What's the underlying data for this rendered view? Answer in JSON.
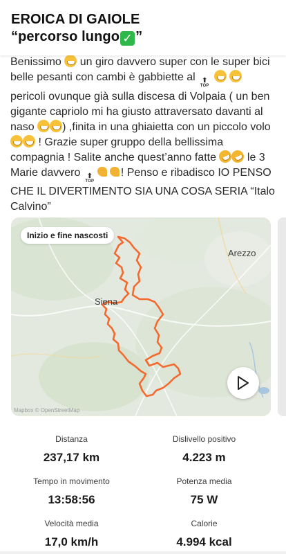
{
  "activity": {
    "title_line1": "EROICA DI GAIOLE",
    "title_line2": "“percorso lungo",
    "title_emoji": "✓",
    "title_end": "”"
  },
  "description": {
    "p1": "Benissimo",
    "p2": "un giro davvero super con le super bici belle pesanti con cambi è gabbiette al",
    "p3": "pericoli ovunque già sulla discesa di Volpaia ( un ben gigante capriolo mi ha giusto attraversato davanti al naso",
    "p4": ") ,finita in una ghiaietta con un piccolo volo",
    "p5": "! Grazie super gruppo della bellissima compagnia ! Salite anche quest’anno fatte",
    "p6": "le 3 Marie davvero",
    "p7": "! Penso e ribadisco IO PENSO CHE IL DIVERTIMENTO SIA UNA COSA SERIA “Italo Calvino”",
    "top_label": "TOP",
    "top_arrow": "⬆"
  },
  "map": {
    "badge": "Inizio e fine nascosti",
    "cities": {
      "arezzo": "Arezzo",
      "siena": "Siena"
    },
    "attribution": "Mapbox © OpenStreetMap",
    "route_color": "#f26a2e",
    "play_icon": "play-icon"
  },
  "stats": [
    {
      "label": "Distanza",
      "value": "237,17 km"
    },
    {
      "label": "Dislivello positivo",
      "value": "4.223 m"
    },
    {
      "label": "Tempo in movimento",
      "value": "13:58:56"
    },
    {
      "label": "Potenza media",
      "value": "75 W"
    },
    {
      "label": "Velocità media",
      "value": "17,0 km/h"
    },
    {
      "label": "Calorie",
      "value": "4.994 kcal"
    }
  ]
}
